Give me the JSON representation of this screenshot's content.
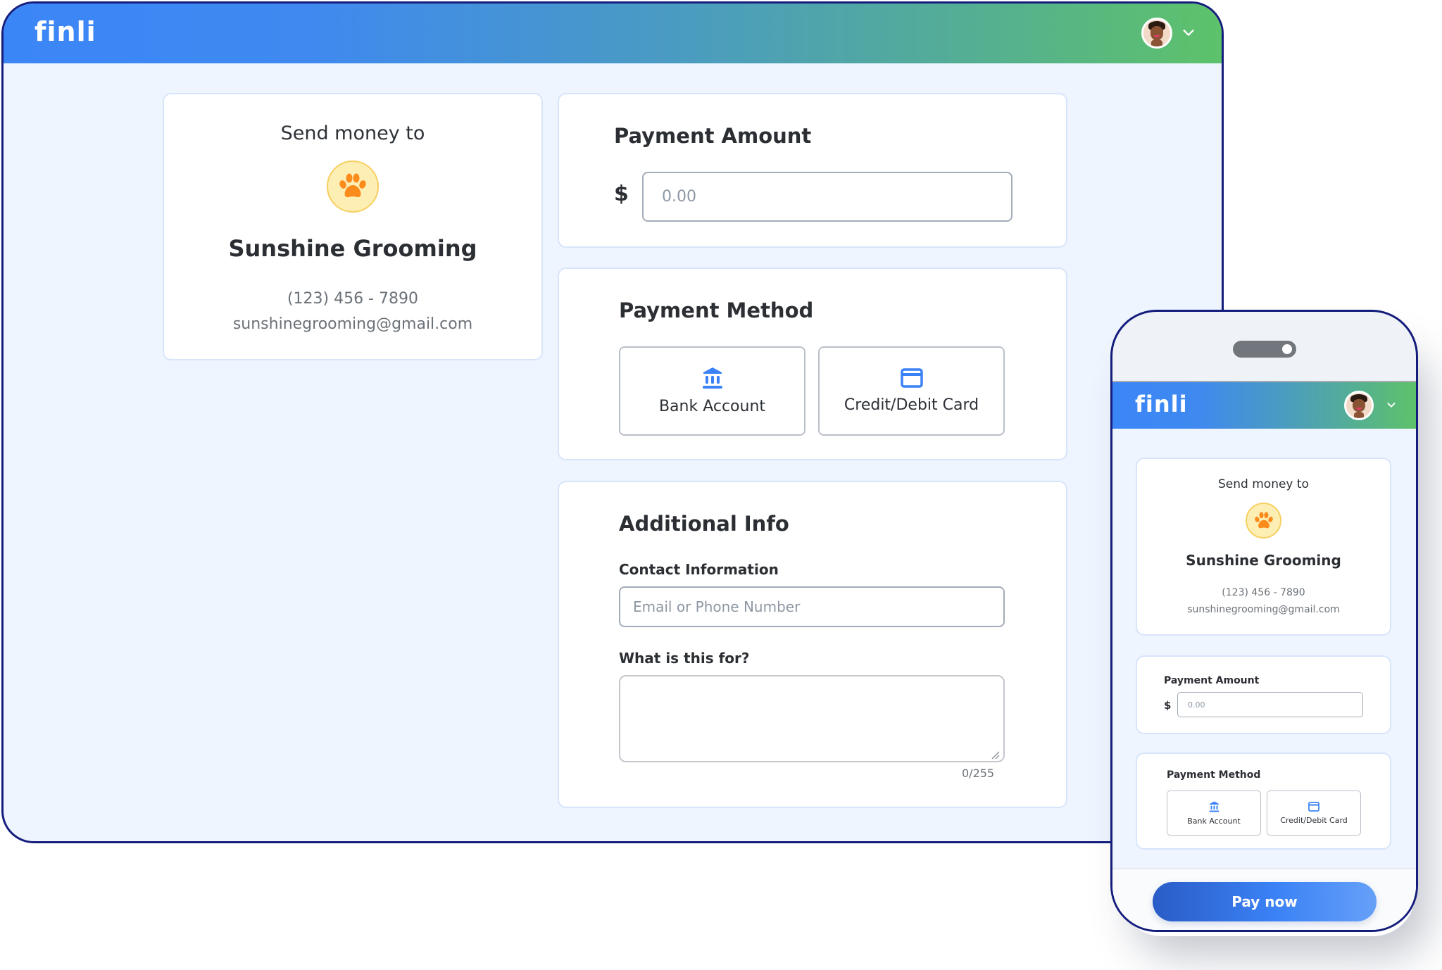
{
  "brand": {
    "name": "finli",
    "primary_color": "#3b82f6",
    "gradient_end_color": "#5dc26a",
    "frame_color": "#141d7c"
  },
  "header": {
    "logo_text": "finli",
    "avatar_icon": "user-avatar",
    "menu_icon": "chevron-down-icon"
  },
  "recipient": {
    "label": "Send money to",
    "icon": "paw-icon",
    "name": "Sunshine Grooming",
    "phone": "(123) 456 - 7890",
    "email": "sunshinegrooming@gmail.com"
  },
  "payment_amount": {
    "title": "Payment Amount",
    "currency_symbol": "$",
    "placeholder": "0.00",
    "value": ""
  },
  "payment_method": {
    "title": "Payment Method",
    "options": [
      {
        "label": "Bank Account",
        "icon": "bank-icon"
      },
      {
        "label": "Credit/Debit Card",
        "icon": "credit-card-icon"
      }
    ]
  },
  "additional_info": {
    "title": "Additional Info",
    "contact_label": "Contact Information",
    "contact_placeholder": "Email or Phone Number",
    "contact_value": "",
    "purpose_label": "What is this for?",
    "purpose_value": "",
    "char_count": "0/255"
  },
  "mobile": {
    "pay_button_label": "Pay now"
  }
}
